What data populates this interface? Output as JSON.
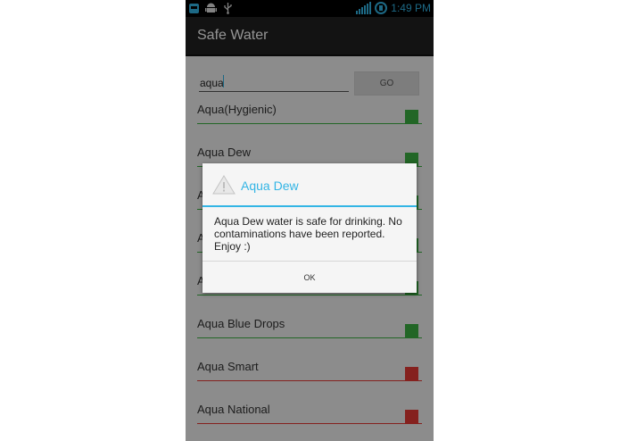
{
  "status_bar": {
    "time": "1:49 PM",
    "left_icons": [
      "notification-app-icon",
      "android-icon",
      "usb-icon"
    ],
    "right_icons": [
      "signal-icon",
      "battery-icon"
    ]
  },
  "action_bar": {
    "title": "Safe Water"
  },
  "search": {
    "value": "aqua",
    "button_label": "GO"
  },
  "list": {
    "items": [
      {
        "label": "Aqua(Hygienic)",
        "status": "safe"
      },
      {
        "label": "Aqua Dew",
        "status": "safe"
      },
      {
        "label": "A",
        "status": "safe"
      },
      {
        "label": "A",
        "status": "safe"
      },
      {
        "label": "A",
        "status": "safe"
      },
      {
        "label": "Aqua Blue Drops",
        "status": "safe"
      },
      {
        "label": "Aqua Smart",
        "status": "unsafe"
      },
      {
        "label": "Aqua National",
        "status": "unsafe"
      }
    ]
  },
  "dialog": {
    "title": "Aqua Dew",
    "icon": "warning-icon",
    "message": "Aqua Dew water is safe for drinking. No contaminations have been reported. Enjoy :)",
    "ok_label": "OK"
  },
  "colors": {
    "accent": "#33b5e5",
    "safe": "#3cb043",
    "unsafe": "#e53935",
    "action_bar": "#222222",
    "status_bar": "#000000"
  }
}
